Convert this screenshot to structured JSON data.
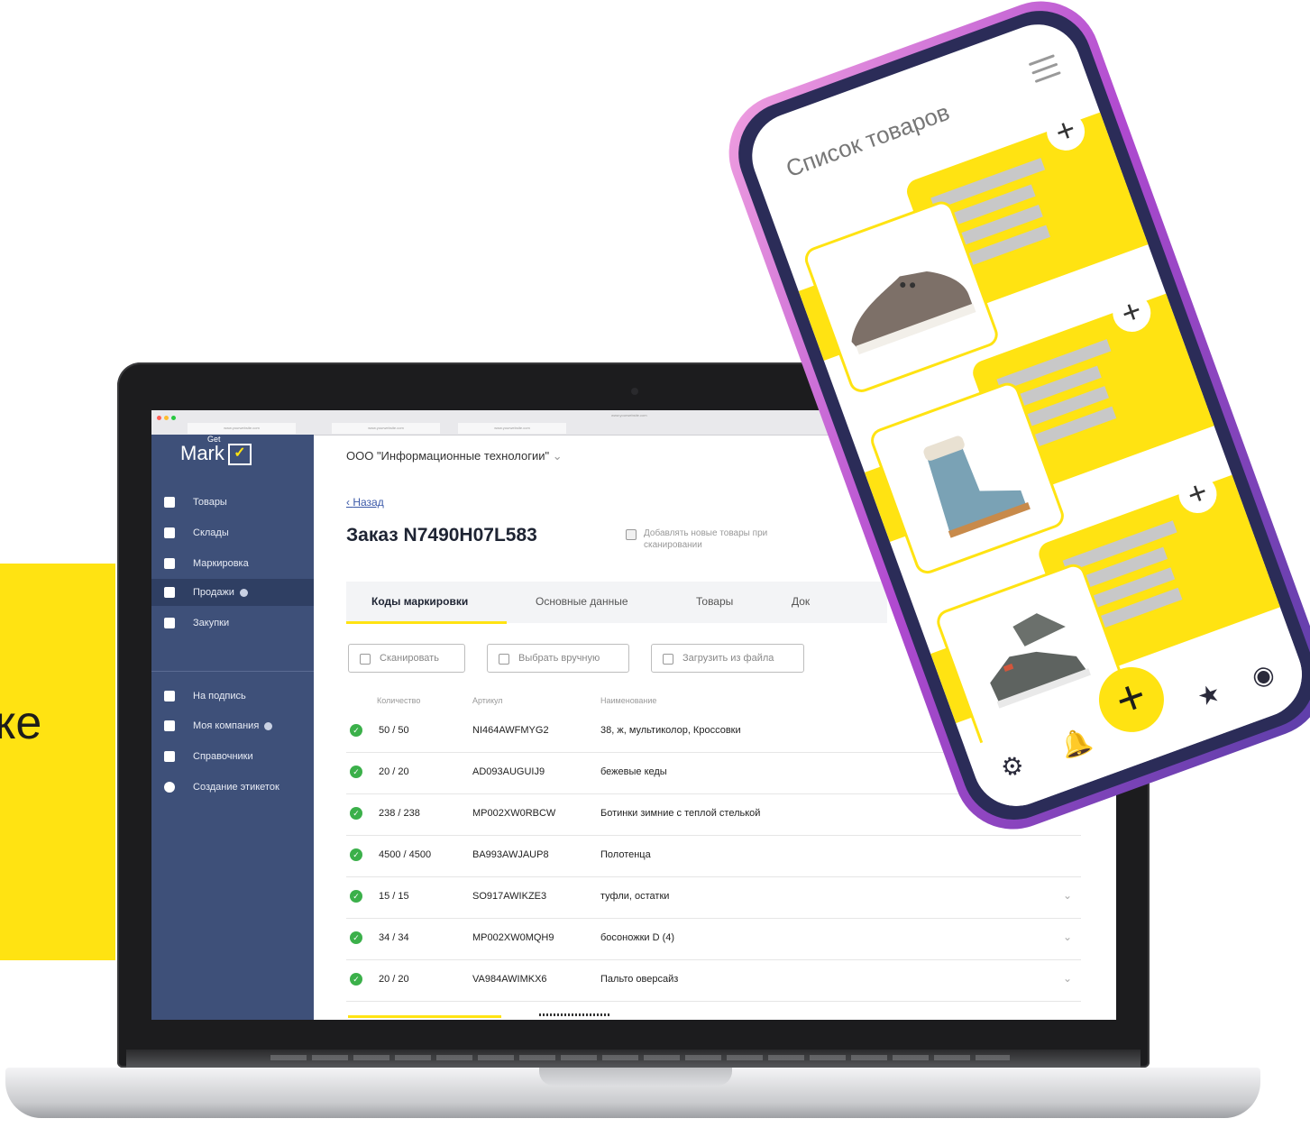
{
  "banner": {
    "text": "ке"
  },
  "browser": {
    "tabs": [
      "www.yourwebsite.com",
      "www.yourwebsite.com",
      "www.yourwebsite.com"
    ],
    "address": "www.yourwebsite.com"
  },
  "sidebar": {
    "logo_get": "Get",
    "logo_text": "Mark",
    "items": [
      {
        "label": "Товары",
        "icon": "box-icon"
      },
      {
        "label": "Склады",
        "icon": "warehouse-icon"
      },
      {
        "label": "Маркировка",
        "icon": "qr-code-icon"
      },
      {
        "label": "Продажи",
        "icon": "clipboard-icon"
      },
      {
        "label": "Закупки",
        "icon": "cart-icon"
      },
      {
        "label": "На подпись",
        "icon": "pen-icon"
      },
      {
        "label": "Моя компания",
        "icon": "building-icon"
      },
      {
        "label": "Справочники",
        "icon": "book-icon"
      },
      {
        "label": "Создание этикеток",
        "icon": "pie-chart-icon"
      }
    ]
  },
  "main": {
    "org": "ООО \"Информационные технологии\"",
    "back": "Назад",
    "order_title": "Заказ N7490H07L583",
    "checkbox_label": "Добавлять новые товары при сканировании",
    "tabs": [
      "Коды маркировки",
      "Основные данные",
      "Товары",
      "Док"
    ],
    "buttons": [
      "Сканировать",
      "Выбрать вручную",
      "Загрузить из файла"
    ],
    "columns": [
      "Количество",
      "Артикул",
      "Наименование"
    ],
    "rows": [
      {
        "qty": "50 / 50",
        "sku": "NI464AWFMYG2",
        "name": "38, ж, мультиколор, Кроссовки"
      },
      {
        "qty": "20 / 20",
        "sku": "AD093AUGUIJ9",
        "name": "бежевые кеды"
      },
      {
        "qty": "238 / 238",
        "sku": "MP002XW0RBCW",
        "name": "Ботинки зимние с теплой стелькой"
      },
      {
        "qty": "4500 / 4500",
        "sku": "BA993AWJAUP8",
        "name": "Полотенца"
      },
      {
        "qty": "15 / 15",
        "sku": "SO917AWIKZE3",
        "name": "туфли, остатки"
      },
      {
        "qty": "34 / 34",
        "sku": "MP002XW0MQH9",
        "name": "босоножки D (4)"
      },
      {
        "qty": "20 / 20",
        "sku": "VA984AWIMKX6",
        "name": "Пальто оверсайз"
      }
    ]
  },
  "phone": {
    "title": "Список товаров",
    "plus": "+",
    "fab": "+"
  },
  "colors": {
    "brand_yellow": "#ffe312",
    "sidebar": "#3e5079",
    "ok_green": "#3bb04a"
  }
}
